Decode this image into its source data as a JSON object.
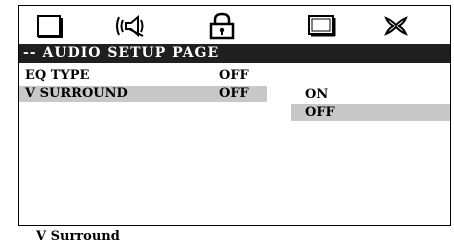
{
  "icons": [
    "tv-screen-icon",
    "speaker-audio-icon",
    "padlock-icon",
    "monitor-icon",
    "exit-x-icon"
  ],
  "title": "-- AUDIO SETUP PAGE",
  "menu": {
    "items": [
      {
        "label": "EQ TYPE",
        "value": "OFF"
      },
      {
        "label": "V SURROUND",
        "value": "OFF"
      }
    ]
  },
  "submenu": {
    "options": [
      "ON",
      "OFF"
    ],
    "selected": "OFF"
  },
  "status_text": "V Surround",
  "colors": {
    "title_bg": "#1f1f1f",
    "highlight": "#c8c8c8",
    "text": "#000000"
  }
}
